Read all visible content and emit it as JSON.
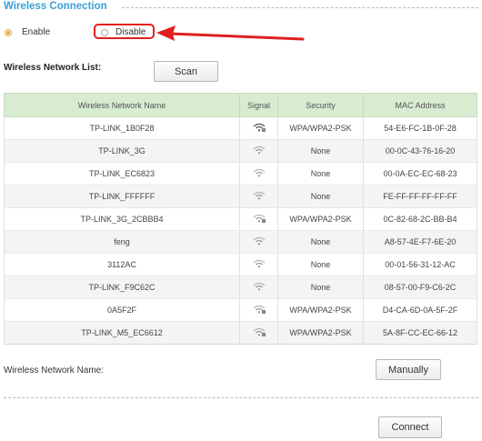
{
  "section": {
    "title": "Wireless Connection"
  },
  "connection": {
    "options": [
      {
        "label": "Enable",
        "checked": true
      },
      {
        "label": "Disable",
        "checked": false
      }
    ]
  },
  "list": {
    "label": "Wireless Network List:",
    "scan_label": "Scan"
  },
  "table": {
    "columns": [
      "Wireless Network Name",
      "Signal",
      "Security",
      "MAC Address"
    ],
    "rows": [
      {
        "name": "TP-LINK_1B0F28",
        "signal": "wifi-strong-locked-icon",
        "security": "WPA/WPA2-PSK",
        "mac": "54-E6-FC-1B-0F-28"
      },
      {
        "name": "TP-LINK_3G",
        "signal": "wifi-medium-icon",
        "security": "None",
        "mac": "00-0C-43-76-16-20"
      },
      {
        "name": "TP-LINK_EC6823",
        "signal": "wifi-medium-icon",
        "security": "None",
        "mac": "00-0A-EC-EC-68-23"
      },
      {
        "name": "TP-LINK_FFFFFF",
        "signal": "wifi-medium-icon",
        "security": "None",
        "mac": "FE-FF-FF-FF-FF-FF"
      },
      {
        "name": "TP-LINK_3G_2CBBB4",
        "signal": "wifi-medium-locked-icon",
        "security": "WPA/WPA2-PSK",
        "mac": "0C-82-68-2C-BB-B4"
      },
      {
        "name": "feng",
        "signal": "wifi-medium-icon",
        "security": "None",
        "mac": "A8-57-4E-F7-6E-20"
      },
      {
        "name": "3112AC",
        "signal": "wifi-medium-icon",
        "security": "None",
        "mac": "00-01-56-31-12-AC"
      },
      {
        "name": "TP-LINK_F9C62C",
        "signal": "wifi-medium-icon",
        "security": "None",
        "mac": "08-57-00-F9-C6-2C"
      },
      {
        "name": "0A5F2F",
        "signal": "wifi-medium-locked-icon",
        "security": "WPA/WPA2-PSK",
        "mac": "D4-CA-6D-0A-5F-2F"
      },
      {
        "name": "TP-LINK_M5_EC6612",
        "signal": "wifi-medium-locked-icon",
        "security": "WPA/WPA2-PSK",
        "mac": "5A-8F-CC-EC-66-12"
      }
    ]
  },
  "network_name": {
    "label": "Wireless Network Name:",
    "manual_label": "Manually"
  },
  "connect_label": "Connect",
  "colors": {
    "accent": "#3a9fd6",
    "highlight": "#e02020",
    "header_bg": "#d7ecd0",
    "radio_checked": "#e8a33a"
  }
}
